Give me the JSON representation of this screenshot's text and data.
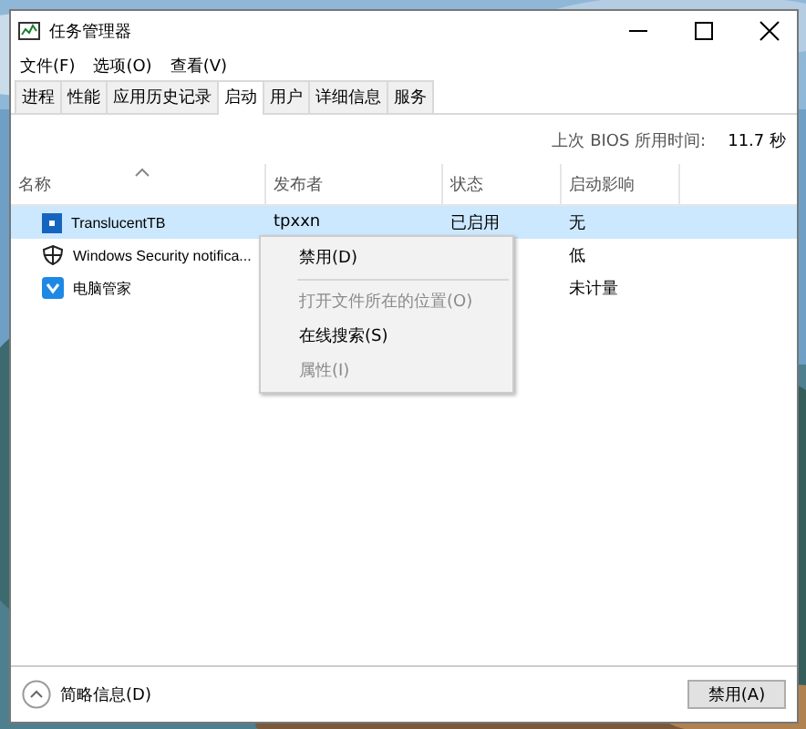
{
  "window": {
    "title": "任务管理器"
  },
  "menu": [
    "文件(F)",
    "选项(O)",
    "查看(V)"
  ],
  "tabs": [
    {
      "label": "进程",
      "selected": false
    },
    {
      "label": "性能",
      "selected": false
    },
    {
      "label": "应用历史记录",
      "selected": false
    },
    {
      "label": "启动",
      "selected": true
    },
    {
      "label": "用户",
      "selected": false
    },
    {
      "label": "详细信息",
      "selected": false
    },
    {
      "label": "服务",
      "selected": false
    }
  ],
  "bios": {
    "label": "上次 BIOS 所用时间:",
    "value": "11.7 秒"
  },
  "table": {
    "columns": [
      "名称",
      "发布者",
      "状态",
      "启动影响"
    ],
    "rows": [
      {
        "kind": "tile",
        "name": "TranslucentTB",
        "publisher": "tpxxn",
        "status": "已启用",
        "impact": "无",
        "selected": true
      },
      {
        "kind": "shield",
        "name": "Windows Security notifica...",
        "publisher": "",
        "status": "",
        "impact": "低",
        "selected": false
      },
      {
        "kind": "guard",
        "name": "电脑管家",
        "publisher": "",
        "status": "",
        "impact": "未计量",
        "selected": false
      }
    ]
  },
  "context_menu": [
    {
      "label": "禁用(D)",
      "disabled": false,
      "separator_after": true
    },
    {
      "label": "打开文件所在的位置(O)",
      "disabled": true,
      "separator_after": false
    },
    {
      "label": "在线搜索(S)",
      "disabled": false,
      "separator_after": false
    },
    {
      "label": "属性(I)",
      "disabled": true,
      "separator_after": false
    }
  ],
  "footer": {
    "toggle": "简略信息(D)",
    "button": "禁用(A)"
  }
}
